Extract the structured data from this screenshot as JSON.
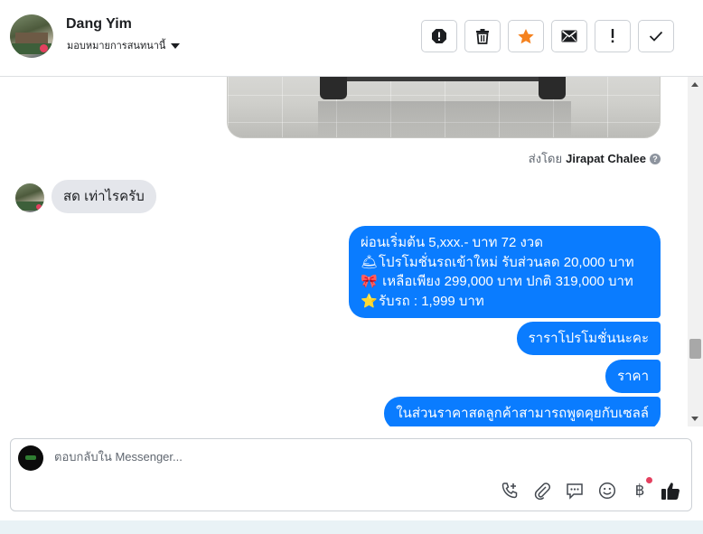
{
  "header": {
    "contact_name": "Dang Yim",
    "assign_label": "มอบหมายการสนทนานี้",
    "actions": [
      {
        "name": "report-icon",
        "title": "รายงาน"
      },
      {
        "name": "trash-icon",
        "title": "ลบ"
      },
      {
        "name": "star-icon",
        "title": "ติดดาว"
      },
      {
        "name": "envelope-icon",
        "title": "ทำเครื่องหมายว่ายังไม่ได้อ่าน"
      },
      {
        "name": "exclamation-icon",
        "title": "สำคัญ"
      },
      {
        "name": "checkmark-icon",
        "title": "เสร็จสิ้น"
      }
    ],
    "colors": {
      "star": "#f5821f"
    }
  },
  "conversation": {
    "sent_by_prefix": "ส่งโดย",
    "sent_by_name": "Jirapat Chalee",
    "incoming_message": "สด เท่าไรครับ",
    "outgoing_promo": {
      "line1": "ผ่อนเริ่มต้น 5,xxx.- บาท 72 งวด",
      "line2_emoji": "🛎",
      "line2": "โปรโมชั่นรถเข้าใหม่ รับส่วนลด 20,000 บาท",
      "line3_emoji": "🎀",
      "line3": " เหลือเพียง 299,000 บาท ปกติ 319,000 บาท",
      "line4_emoji": "⭐",
      "line4": "รับรถ : 1,999 บาท"
    },
    "outgoing_2": "ราราโปรโมชั่นนะคะ",
    "outgoing_3": "ราคา",
    "outgoing_4": "ในส่วนราคาสดลูกค้าสามารถพูดคุยกับเซลล์",
    "colors": {
      "outgoing_bubble": "#0a7cff",
      "incoming_bubble": "#e4e6eb"
    }
  },
  "composer": {
    "placeholder": "ตอบกลับใน Messenger...",
    "tools": [
      "call-add-icon",
      "paperclip-icon",
      "saved-replies-icon",
      "emoji-icon",
      "baht-payment-icon",
      "like-icon"
    ]
  }
}
